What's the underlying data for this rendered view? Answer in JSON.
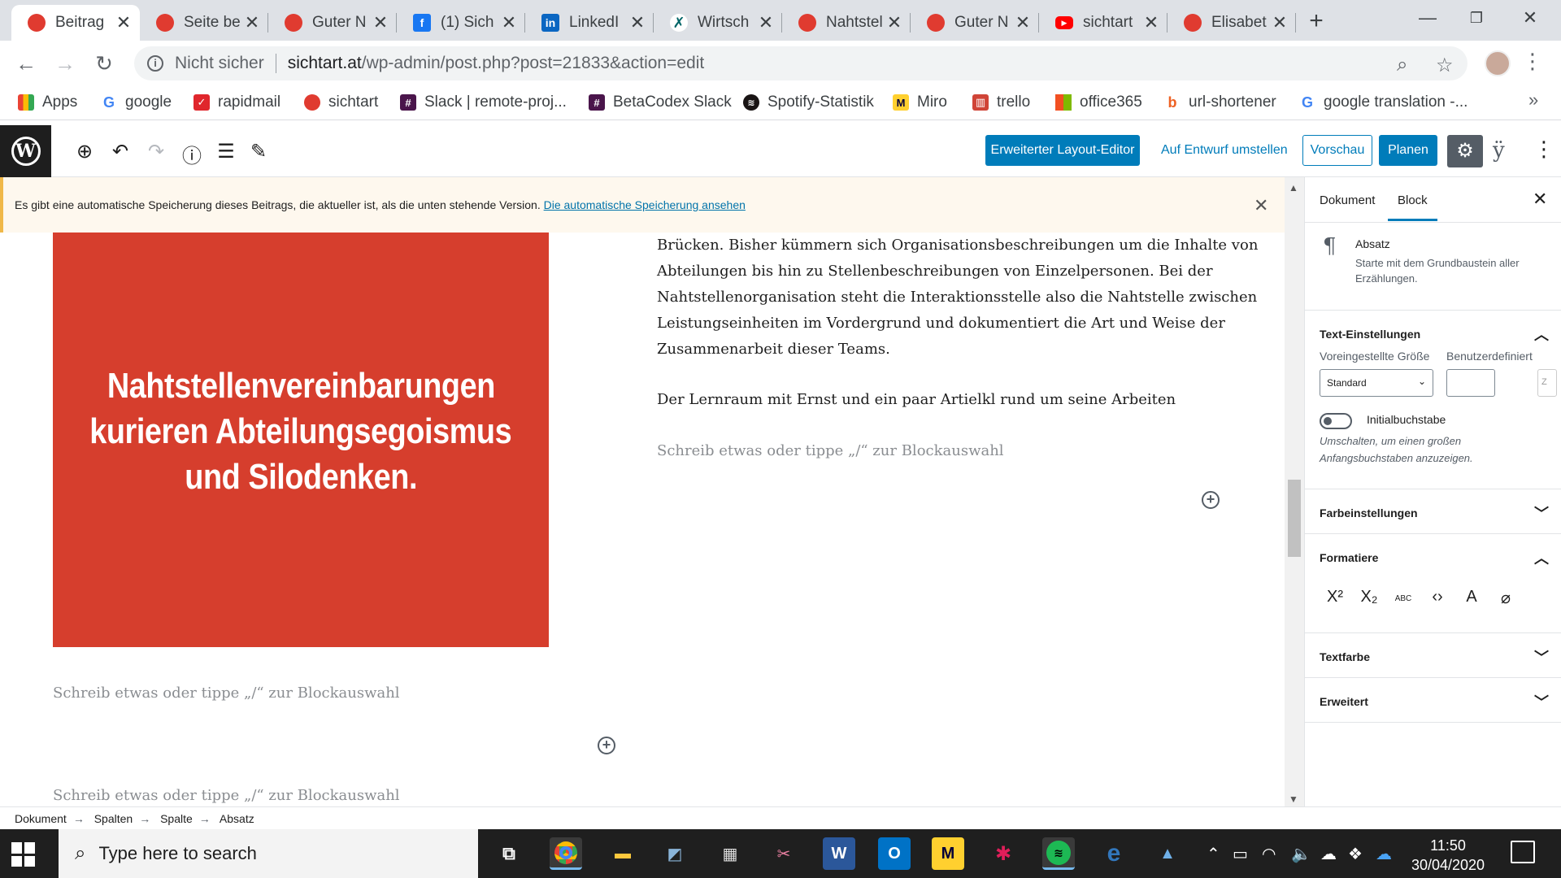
{
  "browser": {
    "tabs": [
      {
        "title": "Beitrag",
        "icon": "sichtart-red-dot-icon",
        "color": "#e03b30",
        "active": true
      },
      {
        "title": "Seite be",
        "icon": "sichtart-red-dot-icon",
        "color": "#e03b30"
      },
      {
        "title": "Guter N",
        "icon": "sichtart-red-dot-icon",
        "color": "#e03b30"
      },
      {
        "title": "(1) Sich",
        "icon": "facebook-icon",
        "color": "#1877f2"
      },
      {
        "title": "LinkedI",
        "icon": "linkedin-icon",
        "color": "#0a66c2"
      },
      {
        "title": "Wirtsch",
        "icon": "xing-icon",
        "color": "#006567"
      },
      {
        "title": "Nahtstel",
        "icon": "sichtart-red-dot-icon",
        "color": "#e03b30"
      },
      {
        "title": "Guter N",
        "icon": "sichtart-red-dot-icon",
        "color": "#e03b30"
      },
      {
        "title": "sichtart",
        "icon": "youtube-icon",
        "color": "#ff0000"
      },
      {
        "title": "Elisabet",
        "icon": "sichtart-red-dot-icon",
        "color": "#e03b30"
      }
    ],
    "new_tab_icon": "plus-icon",
    "address": {
      "security": "Nicht sicher",
      "host": "sichtart.at",
      "path": "/wp-admin/post.php?post=21833&action=edit"
    },
    "bookmarks": [
      {
        "label": "Apps",
        "icon": "apps-grid-icon",
        "color": "#4285f4"
      },
      {
        "label": "google",
        "icon": "google-icon",
        "color": "#4285f4"
      },
      {
        "label": "rapidmail",
        "icon": "rapidmail-icon",
        "color": "#e0262c"
      },
      {
        "label": "sichtart",
        "icon": "sichtart-red-dot-icon",
        "color": "#e03b30"
      },
      {
        "label": "Slack | remote-proj...",
        "icon": "slack-icon",
        "color": "#4a154b"
      },
      {
        "label": "BetaCodex Slack",
        "icon": "slack-icon",
        "color": "#4a154b"
      },
      {
        "label": "Spotify-Statistik",
        "icon": "spotify-icon",
        "color": "#191414"
      },
      {
        "label": "Miro",
        "icon": "miro-icon",
        "color": "#ffd02f"
      },
      {
        "label": "trello",
        "icon": "trello-icon",
        "color": "#d04437"
      },
      {
        "label": "office365",
        "icon": "office-icon",
        "color": "#f25022"
      },
      {
        "label": "url-shortener",
        "icon": "bitly-icon",
        "color": "#ee6123"
      },
      {
        "label": "google translation -...",
        "icon": "google-icon",
        "color": "#4285f4"
      }
    ]
  },
  "wp_toolbar": {
    "layout_editor": "Erweiterter Layout-Editor",
    "draft": "Auf Entwurf umstellen",
    "preview": "Vorschau",
    "schedule": "Planen"
  },
  "notice": {
    "text": "Es gibt eine automatische Speicherung dieses Beitrags, die aktueller ist, als die unten stehende Version. ",
    "link": "Die automatische Speicherung ansehen"
  },
  "content": {
    "image_lines": [
      "Nahtstellenvereinbarungen",
      "kurieren Abteilungsegoismus",
      "und Silodenken."
    ],
    "paragraph_lines": [
      "Brücken. Bisher kümmern sich Organisationsbeschreibungen um die Inhalte von",
      "Abteilungen bis hin zu Stellenbeschreibungen von Einzelpersonen. Bei der",
      "Nahtstellenorganisation steht die Interaktionsstelle also die Nahtstelle zwischen",
      "Leistungseinheiten im Vordergrund und dokumentiert die Art und Weise der",
      "Zusammenarbeit dieser Teams."
    ],
    "paragraph2": "Der Lernraum mit Ernst und ein paar Artielkl rund um seine Arbeiten",
    "placeholder": "Schreib etwas oder tippe „/“ zur Blockauswahl"
  },
  "sidebar": {
    "tab_document": "Dokument",
    "tab_block": "Block",
    "block_title": "Absatz",
    "block_desc": "Starte mit dem Grundbaustein aller Erzählungen.",
    "text_settings": "Text-Einstellungen",
    "size_label": "Voreingestellte Größe",
    "custom_label": "Benutzerdefiniert",
    "size_value": "Standard",
    "reset_short": "Z",
    "dropcap_label": "Initialbuchstabe",
    "dropcap_help": "Umschalten, um einen großen Anfangsbuchstaben anzuzeigen.",
    "color_settings": "Farbeinstellungen",
    "format": "Formatiere",
    "text_color": "Textfarbe",
    "advanced": "Erweitert"
  },
  "breadcrumb": [
    "Dokument",
    "Spalten",
    "Spalte",
    "Absatz"
  ],
  "taskbar": {
    "search_placeholder": "Type here to search",
    "time": "11:50",
    "date": "30/04/2020"
  }
}
